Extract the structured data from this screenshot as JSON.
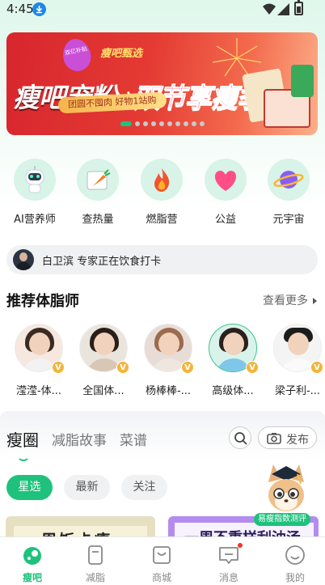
{
  "status_bar": {
    "time": "4:45",
    "icons": [
      "download-icon",
      "wifi-icon",
      "signal-icon",
      "battery-icon"
    ]
  },
  "banner": {
    "badge": "双亿补贴",
    "brand": "瘦吧甄选",
    "title_part1": "瘦吧宠粉",
    "title_part2": "之",
    "title_part3": "双节享瘦季",
    "subtitle": "团圆不囤肉 好物1站购",
    "dots_total": 10,
    "dots_active": 0
  },
  "quick_menu": [
    {
      "label": "AI营养师",
      "icon": "robot-icon"
    },
    {
      "label": "查热量",
      "icon": "carrot-icon"
    },
    {
      "label": "燃脂营",
      "icon": "flame-icon"
    },
    {
      "label": "公益",
      "icon": "heart-icon"
    },
    {
      "label": "元宇宙",
      "icon": "planet-icon"
    }
  ],
  "expert_bar": {
    "name": "白卫滨",
    "text": "白卫滨  专家正在饮食打卡"
  },
  "recommend": {
    "title": "推荐体脂师",
    "see_more": "查看更多",
    "coaches": [
      {
        "name": "滢滢-体...",
        "badge": "V"
      },
      {
        "name": "全国体...",
        "badge": "V"
      },
      {
        "name": "杨棒棒-...",
        "badge": "V"
      },
      {
        "name": "高级体...",
        "badge": "V"
      },
      {
        "name": "梁子利-...",
        "badge": "V"
      }
    ]
  },
  "feed": {
    "tabs": [
      {
        "label": "瘦圈",
        "active": true
      },
      {
        "label": "减脂故事",
        "active": false
      },
      {
        "label": "菜谱",
        "active": false
      }
    ],
    "publish_label": "发布",
    "chips": [
      {
        "label": "星选",
        "active": true
      },
      {
        "label": "最新",
        "active": false
      },
      {
        "label": "关注",
        "active": false
      }
    ],
    "cards": [
      {
        "text": "一周饭卡瘦"
      },
      {
        "text": "一周不重样刮油汤"
      }
    ]
  },
  "mascot": {
    "label": "易瘦指数测评"
  },
  "bottom_nav": [
    {
      "label": "瘦吧",
      "icon": "home-icon",
      "active": true
    },
    {
      "label": "减脂",
      "icon": "notebook-icon",
      "active": false
    },
    {
      "label": "商城",
      "icon": "shop-bag-icon",
      "active": false
    },
    {
      "label": "消息",
      "icon": "message-icon",
      "active": false,
      "has_dot": true
    },
    {
      "label": "我的",
      "icon": "profile-icon",
      "active": false
    }
  ],
  "colors": {
    "brand_green": "#1ec27c",
    "banner_red": "#d7262e",
    "notification_red": "#f2352e"
  }
}
